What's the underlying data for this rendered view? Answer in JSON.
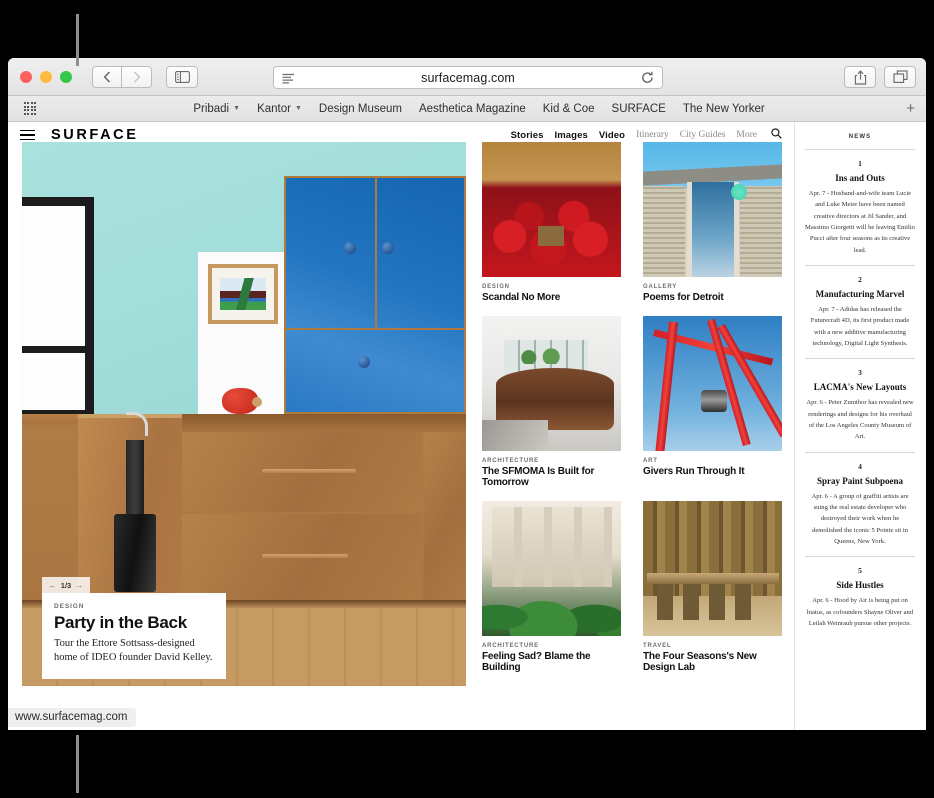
{
  "browser": {
    "traffic_lights": [
      "close",
      "minimize",
      "zoom"
    ],
    "back_label": "‹",
    "forward_label": "›",
    "sidebar_icon": "sidebar-icon",
    "reader_icon": "reader-view-icon",
    "reload_icon": "reload-icon",
    "share_icon": "share-icon",
    "tabs_icon": "show-tabs-icon",
    "address": "surfacemag.com",
    "status_url": "www.surfacemag.com",
    "bookmarks_plus": "+",
    "bookmarks": [
      {
        "label": "Pribadi",
        "has_chevron": true
      },
      {
        "label": "Kantor",
        "has_chevron": true
      },
      {
        "label": "Design Museum",
        "has_chevron": false
      },
      {
        "label": "Aesthetica Magazine",
        "has_chevron": false
      },
      {
        "label": "Kid & Coe",
        "has_chevron": false
      },
      {
        "label": "SURFACE",
        "has_chevron": false
      },
      {
        "label": "The New Yorker",
        "has_chevron": false
      }
    ]
  },
  "site": {
    "brand": "SURFACE",
    "nav_primary": [
      "Stories",
      "Images",
      "Video"
    ],
    "nav_secondary": [
      "Itinerary",
      "City Guides",
      "More"
    ],
    "search_icon": "search-icon"
  },
  "hero": {
    "counter": "1/3",
    "prev_arrow": "←",
    "next_arrow": "→",
    "kicker": "DESIGN",
    "title": "Party in the Back",
    "dek": "Tour the Ettore Sottsass-designed home of IDEO founder David Kelley."
  },
  "grid": [
    {
      "kicker": "DESIGN",
      "title": "Scandal No More",
      "art": "t-seats"
    },
    {
      "kicker": "GALLERY",
      "title": "Poems for Detroit",
      "art": "t-gallery"
    },
    {
      "kicker": "ARCHITECTURE",
      "title": "The SFMOMA Is Built for Tomorrow",
      "art": "t-corten"
    },
    {
      "kicker": "ART",
      "title": "Givers Run Through It",
      "art": "t-red"
    },
    {
      "kicker": "ARCHITECTURE",
      "title": "Feeling Sad? Blame the Building",
      "art": "t-plants"
    },
    {
      "kicker": "TRAVEL",
      "title": "The Four Seasons's New Design Lab",
      "art": "t-bar"
    }
  ],
  "news": {
    "header": "NEWS",
    "items": [
      {
        "number": "1",
        "title": "Ins and Outs",
        "body": "Apr. 7 - Husband-and-wife team Lucie and Luke Meier have been named creative directors at Jil Sander, and Massimo Giorgetti will be leaving Emilio Pucci after four seasons as its creative lead."
      },
      {
        "number": "2",
        "title": "Manufacturing Marvel",
        "body": "Apr. 7 - Adidas has released the Futurecraft 4D, its first product made with a new additive manufacturing technology, Digital Light Synthesis."
      },
      {
        "number": "3",
        "title": "LACMA's New Layouts",
        "body": "Apr. 6 - Peter Zumthor has revealed new renderings and designs for his overhaul of the Los Angeles County Museum of Art."
      },
      {
        "number": "4",
        "title": "Spray Paint Subpoena",
        "body": "Apr. 6 - A group of graffiti artists are suing the real estate developer who destroyed their work when he demolished the iconic 5 Pointz sit in Queens, New York."
      },
      {
        "number": "5",
        "title": "Side Hustles",
        "body": "Apr. 6 - Hood by Air is being put on hiatus, as cofounders Shayne Oliver and Leilah Weinraub pursue other projects."
      }
    ]
  }
}
